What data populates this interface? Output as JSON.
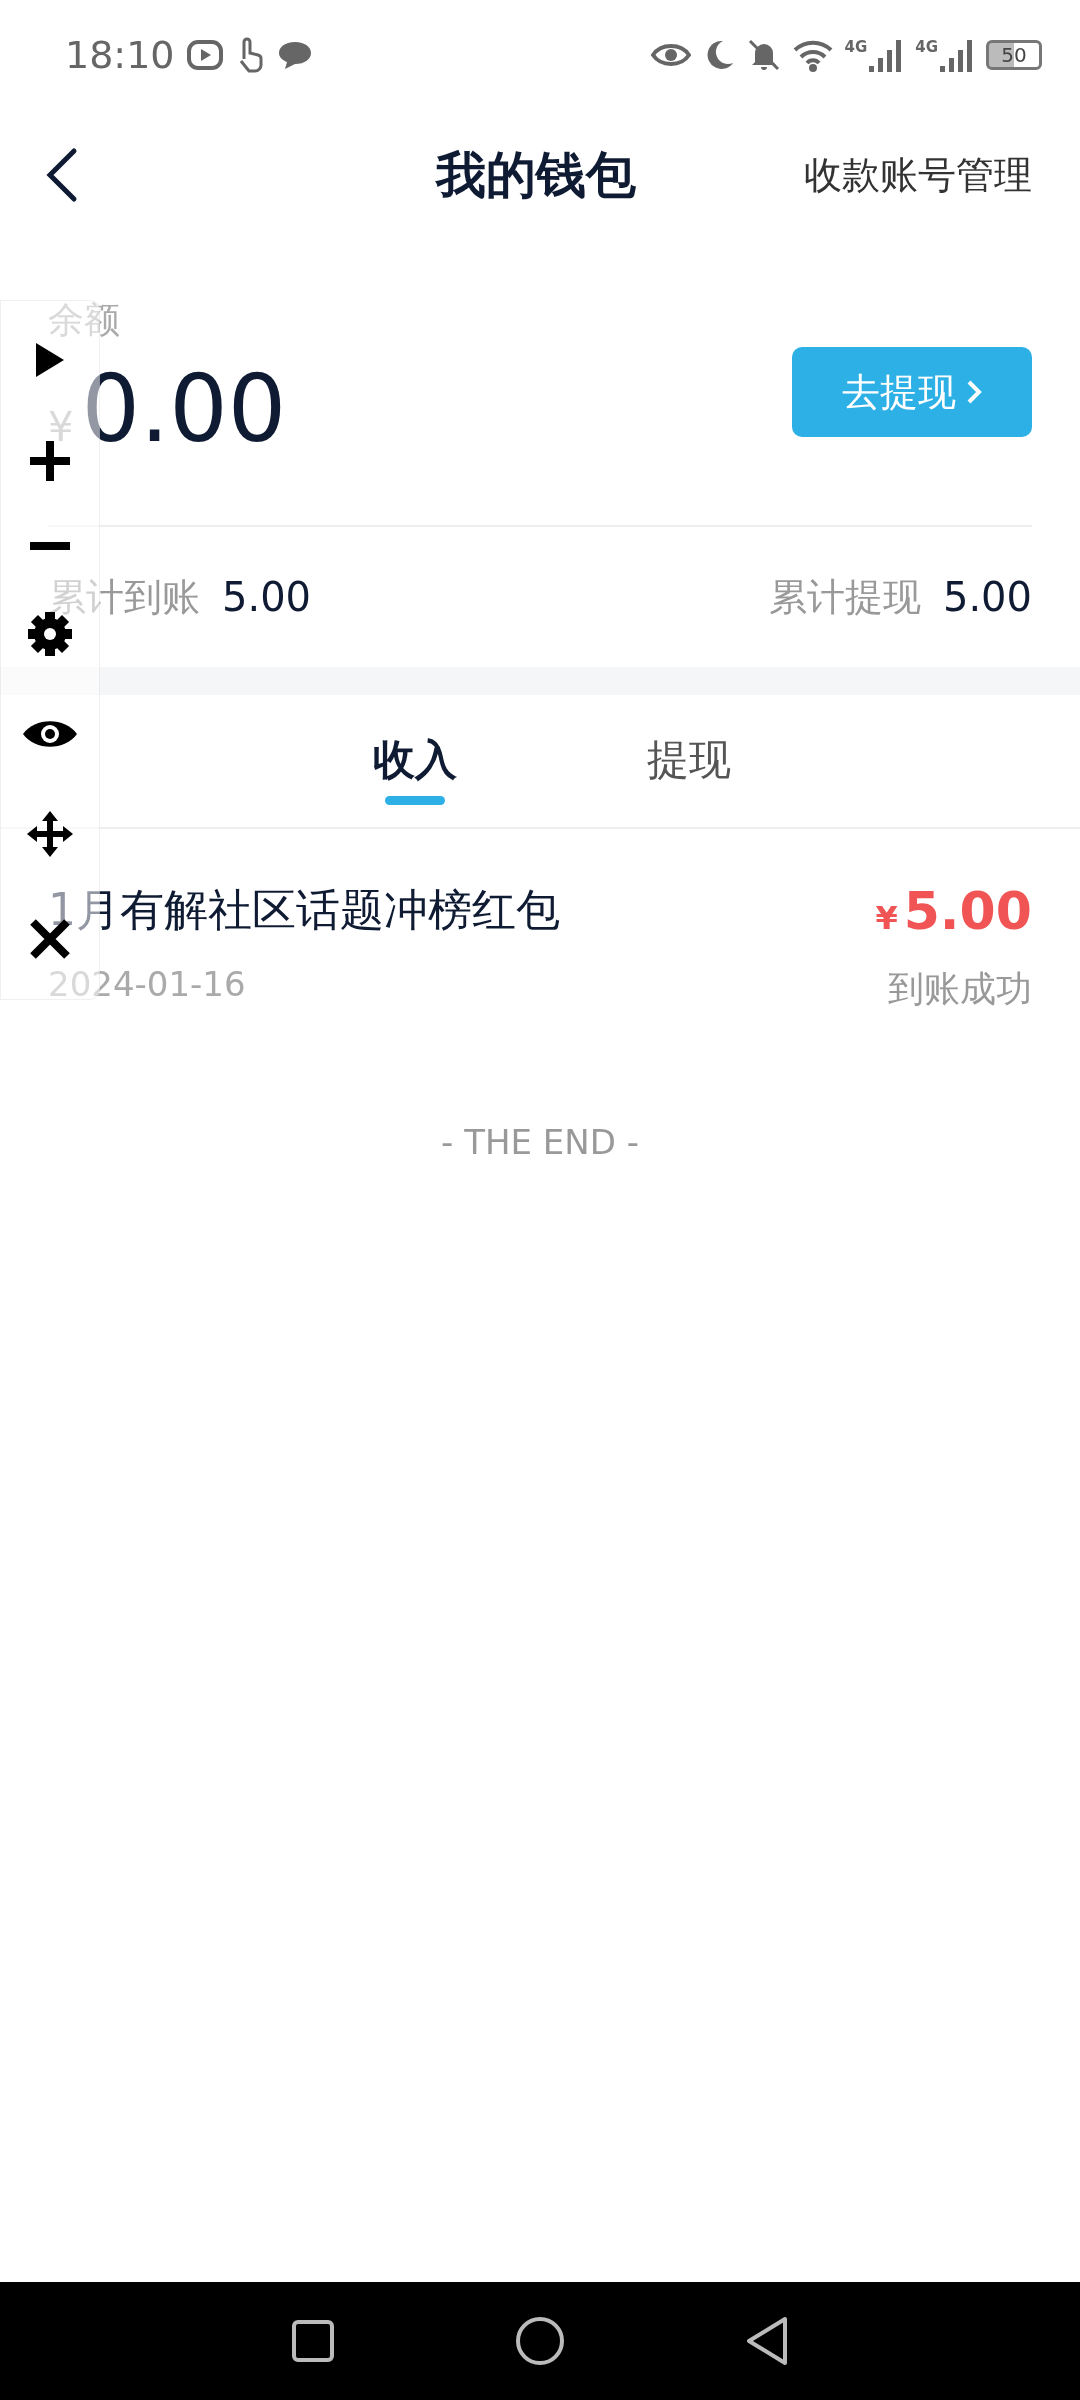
{
  "status_bar": {
    "time": "18:10",
    "signals": [
      {
        "label": "4G"
      },
      {
        "label": "4G"
      }
    ],
    "battery": "50"
  },
  "header": {
    "title": "我的钱包",
    "action": "收款账号管理"
  },
  "balance": {
    "label": "余额",
    "currency": "¥",
    "amount": "0.00",
    "button": "去提现"
  },
  "totals": [
    {
      "label": "累计到账",
      "value": "5.00"
    },
    {
      "label": "累计提现",
      "value": "5.00"
    }
  ],
  "tabs": [
    {
      "label": "收入",
      "selected": true
    },
    {
      "label": "提现",
      "selected": false
    }
  ],
  "records": [
    {
      "title": "1月有解社区话题冲榜红包",
      "date": "2024-01-16",
      "currency": "¥",
      "amount": "5.00",
      "status": "到账成功"
    }
  ],
  "end_text": "- THE END -"
}
